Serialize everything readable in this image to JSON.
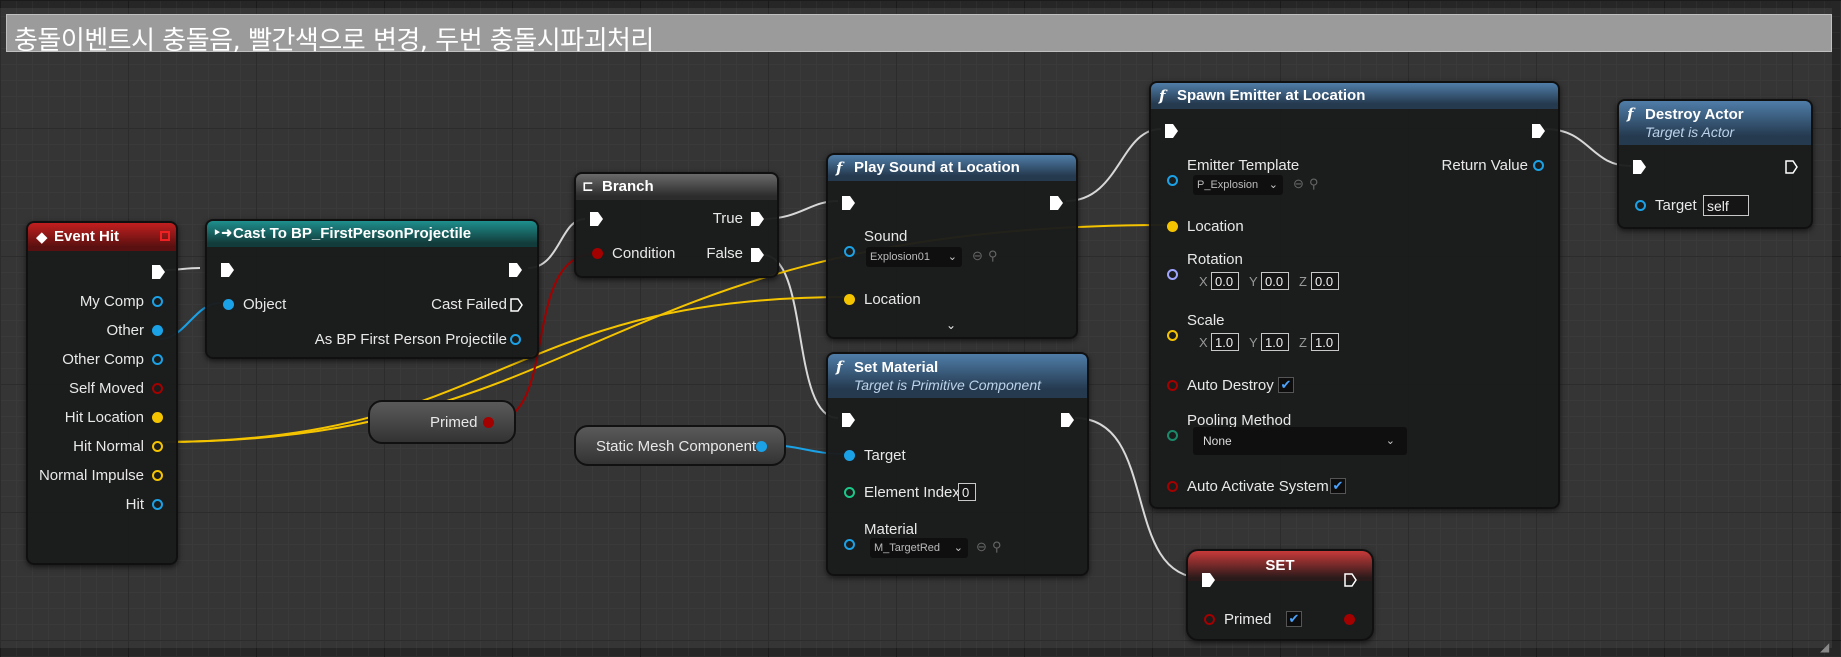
{
  "comment": {
    "title": "충돌이벤트시 충돌음, 빨간색으로 변경, 두번 충돌시파괴처리"
  },
  "colors": {
    "exec": "#ffffff",
    "object": "#1aa1e6",
    "vector": "#f5c400",
    "bool": "#a30000",
    "int": "#1ac98a",
    "rotator": "#9fa5ff",
    "event_header": "#a81818",
    "cast_header": "#1a7a78",
    "func_header": "#4f7da8",
    "set_header": "#b83030"
  },
  "event_hit": {
    "title": "Event Hit",
    "pins": [
      "My Comp",
      "Other",
      "Other Comp",
      "Self Moved",
      "Hit Location",
      "Hit Normal",
      "Normal Impulse",
      "Hit"
    ]
  },
  "cast": {
    "title": "Cast To BP_FirstPersonProjectile",
    "object_label": "Object",
    "cast_failed_label": "Cast Failed",
    "as_label": "As BP First Person Projectile"
  },
  "branch": {
    "title": "Branch",
    "true_label": "True",
    "false_label": "False",
    "condition_label": "Condition"
  },
  "primed_getter": {
    "label": "Primed"
  },
  "static_mesh": {
    "label": "Static Mesh Component"
  },
  "play_sound": {
    "title": "Play Sound at Location",
    "sound_label": "Sound",
    "sound_value": "Explosion01",
    "location_label": "Location",
    "expand_icon": "chevron-down-icon"
  },
  "set_material": {
    "title": "Set Material",
    "subtitle": "Target is Primitive Component",
    "target_label": "Target",
    "element_index_label": "Element Index",
    "element_index_value": "0",
    "material_label": "Material",
    "material_value": "M_TargetRed"
  },
  "spawn_emitter": {
    "title": "Spawn Emitter at Location",
    "emitter_label": "Emitter Template",
    "emitter_value": "P_Explosion",
    "return_label": "Return Value",
    "location_label": "Location",
    "rotation_label": "Rotation",
    "rotation": {
      "x": "0.0",
      "y": "0.0",
      "z": "0.0"
    },
    "scale_label": "Scale",
    "scale": {
      "x": "1.0",
      "y": "1.0",
      "z": "1.0"
    },
    "axis_x": "X",
    "axis_y": "Y",
    "axis_z": "Z",
    "auto_destroy_label": "Auto Destroy",
    "auto_destroy": true,
    "pooling_label": "Pooling Method",
    "pooling_value": "None",
    "auto_activate_label": "Auto Activate System",
    "auto_activate": true
  },
  "destroy_actor": {
    "title": "Destroy Actor",
    "subtitle": "Target is Actor",
    "target_label": "Target",
    "target_value": "self"
  },
  "set_node": {
    "title": "SET",
    "primed_label": "Primed",
    "primed_value": true
  }
}
